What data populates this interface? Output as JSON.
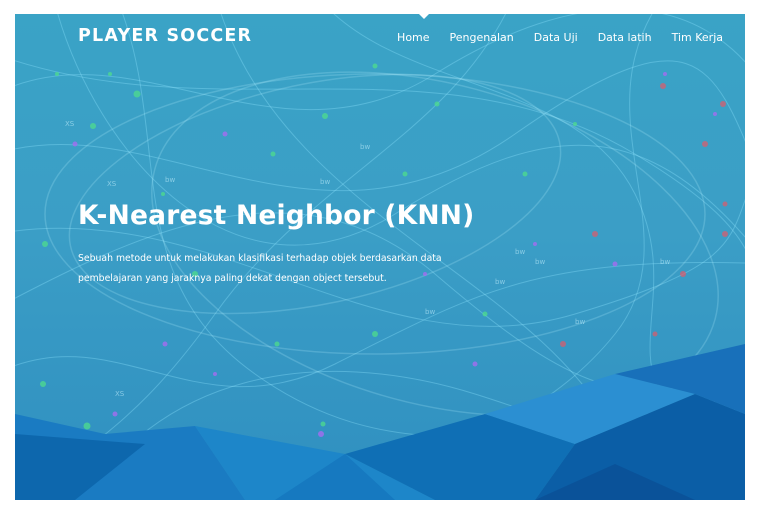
{
  "brand": "PLAYER SOCCER",
  "nav": {
    "items": [
      {
        "label": "Home"
      },
      {
        "label": "Pengenalan"
      },
      {
        "label": "Data Uji"
      },
      {
        "label": "Data latih"
      },
      {
        "label": "Tim Kerja"
      }
    ]
  },
  "hero": {
    "title": "K-Nearest Neighbor (KNN)",
    "description": "Sebuah metode untuk melakukan klasifikasi terhadap objek berdasarkan data pembelajaran yang jaraknya paling dekat dengan object tersebut."
  },
  "colors": {
    "hero_bg": "#3aa3c6",
    "lines": "#7fe0ff",
    "dots_green": "#4fdc8c",
    "dots_purple": "#a56df0",
    "dots_red": "#e05a6a",
    "polygon_dark": "#0d5fa3",
    "polygon_mid": "#1a7bc2",
    "polygon_light": "#2d8ad0"
  }
}
